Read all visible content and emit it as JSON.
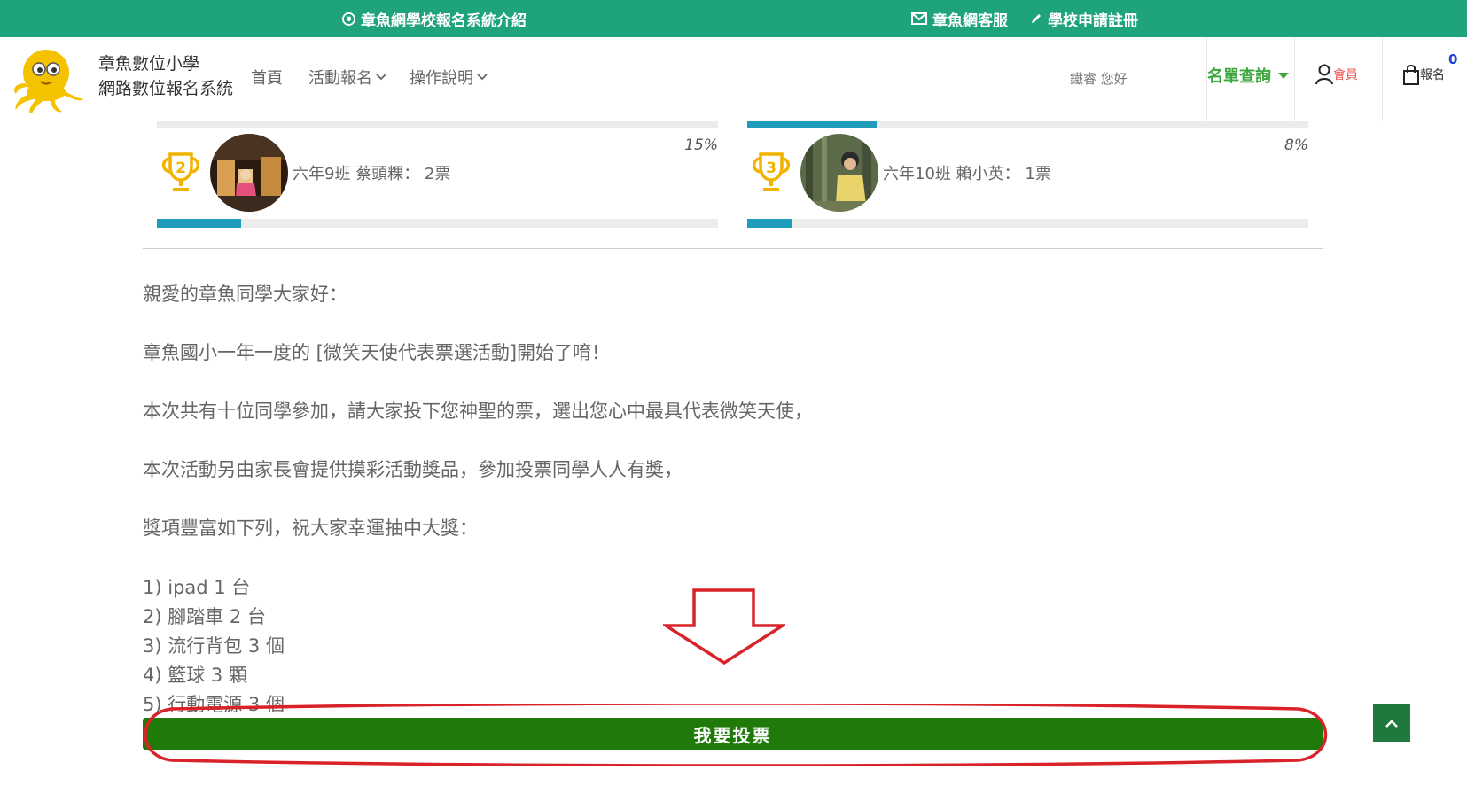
{
  "topbar": {
    "intro_label": "章魚網學校報名系統介紹",
    "service_label": "章魚網客服",
    "register_label": "學校申請註冊",
    "bg_color": "#1fa37c"
  },
  "header": {
    "title_line1": "章魚數位小學",
    "title_line2": "網路數位報名系統",
    "nav": [
      {
        "label": "首頁",
        "has_dropdown": false
      },
      {
        "label": "活動報名",
        "has_dropdown": true
      },
      {
        "label": "操作說明",
        "has_dropdown": true
      }
    ],
    "greeting": "鐵睿 您好",
    "list_query_label": "名單查詢",
    "member_label": "會員",
    "signup_label": "報名",
    "cart_count": "0"
  },
  "rankings": [
    {
      "rank": "2",
      "class_name": "六年9班",
      "student": "蔡頭粿",
      "votes_text": "2票",
      "percent_label": "15%",
      "percent": 15
    },
    {
      "rank": "3",
      "class_name": "六年10班",
      "student": "賴小英",
      "votes_text": "1票",
      "percent_label": "8%",
      "percent": 8
    }
  ],
  "previous_bars": {
    "left_percent": 0,
    "right_percent": 23
  },
  "content": {
    "greeting": "親愛的章魚同學大家好：",
    "p1": "章魚國小一年一度的 [微笑天使代表票選活動]開始了唷！",
    "p2": "本次共有十位同學參加，請大家投下您神聖的票，選出您心中最具代表微笑天使，",
    "p3": "本次活動另由家長會提供摸彩活動獎品，參加投票同學人人有獎，",
    "p4": "獎項豐富如下列，祝大家幸運抽中大獎：",
    "prizes": [
      "1) ipad 1 台",
      "2) 腳踏車 2 台",
      "3) 流行背包 3 個",
      "4) 籃球 3 顆",
      "5) 行動電源 3 個"
    ]
  },
  "vote_button_label": "我要投票",
  "colors": {
    "accent_green": "#1f7a0a",
    "progress_blue": "#1f9bbb",
    "highlight_red": "#d9232a",
    "trophy_gold": "#f0b400"
  }
}
